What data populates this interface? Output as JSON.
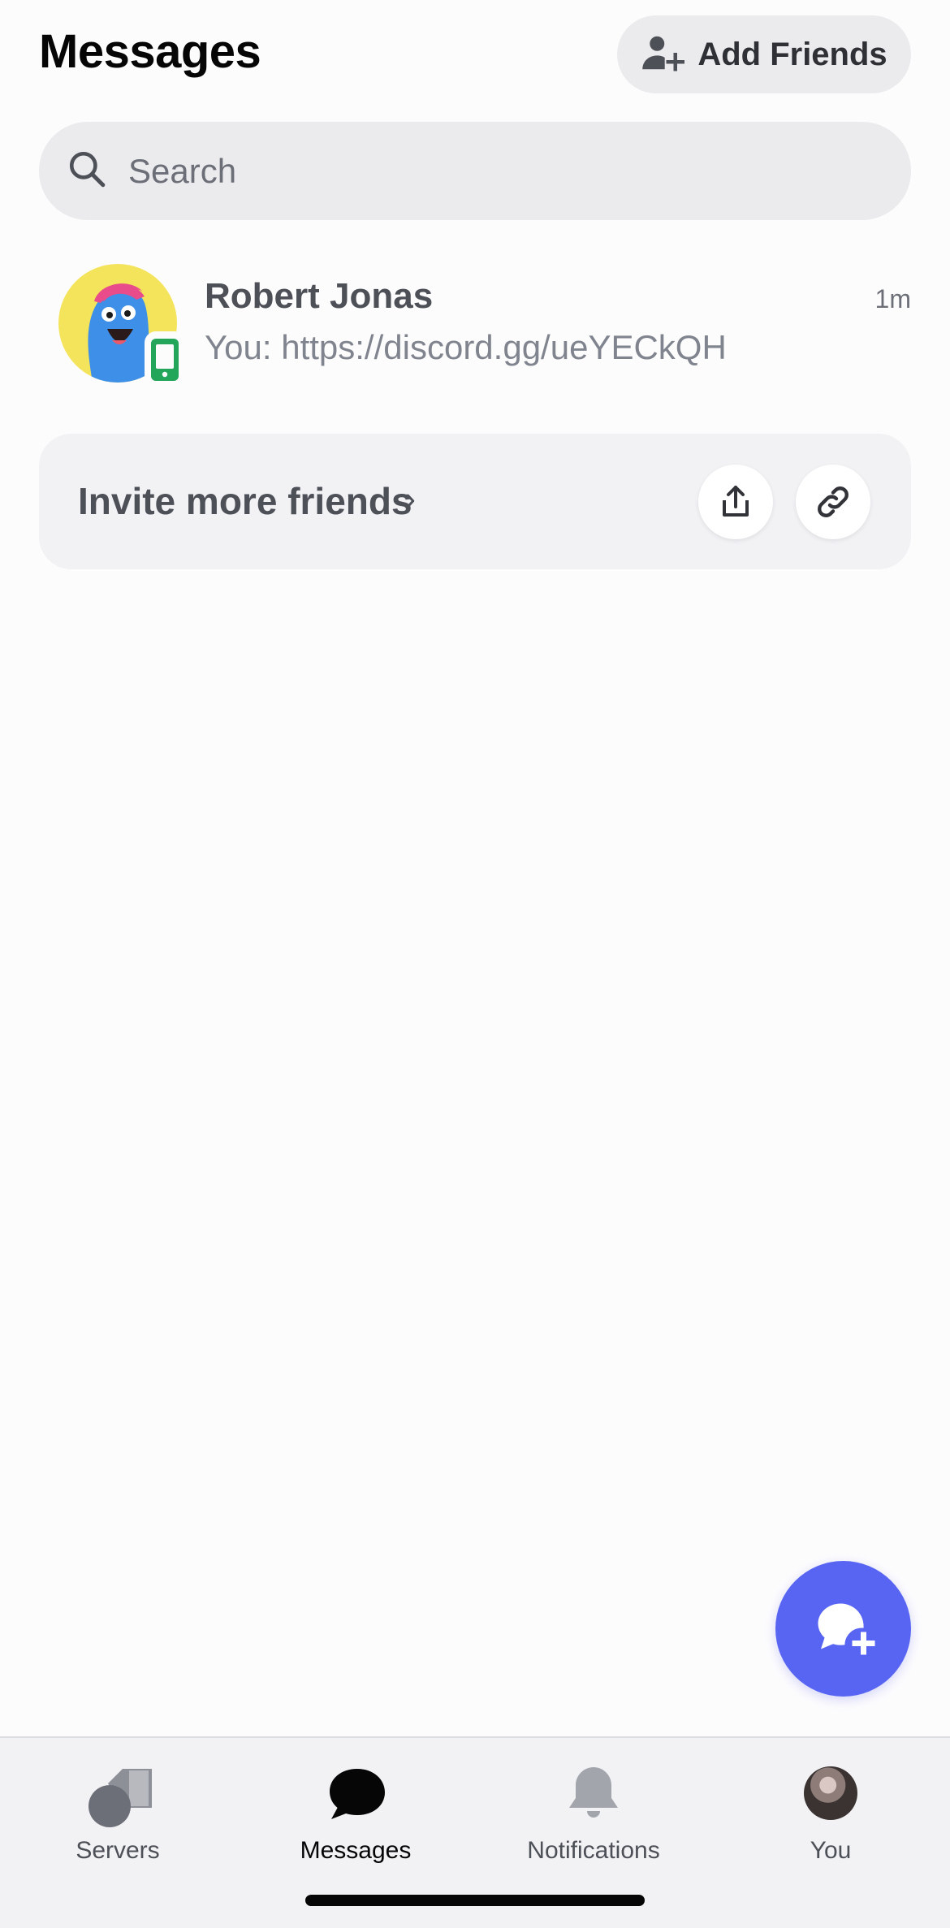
{
  "header": {
    "title": "Messages",
    "add_friends_label": "Add Friends"
  },
  "search": {
    "placeholder": "Search"
  },
  "conversations": [
    {
      "name": "Robert Jonas",
      "preview": "You: https://discord.gg/ueYECkQH",
      "time": "1m",
      "status": "mobile-online"
    }
  ],
  "invite": {
    "label": "Invite more friends",
    "chevron": "›",
    "actions": [
      "share-icon",
      "link-icon"
    ]
  },
  "fab": {
    "icon": "new-message-icon"
  },
  "bottom_nav": {
    "items": [
      {
        "label": "Servers",
        "icon": "servers-icon",
        "active": false
      },
      {
        "label": "Messages",
        "icon": "messages-icon",
        "active": true
      },
      {
        "label": "Notifications",
        "icon": "bell-icon",
        "active": false
      },
      {
        "label": "You",
        "icon": "profile-avatar",
        "active": false
      }
    ]
  },
  "colors": {
    "accent": "#5865f2",
    "online": "#23a55a",
    "background": "#fdfcfd"
  }
}
